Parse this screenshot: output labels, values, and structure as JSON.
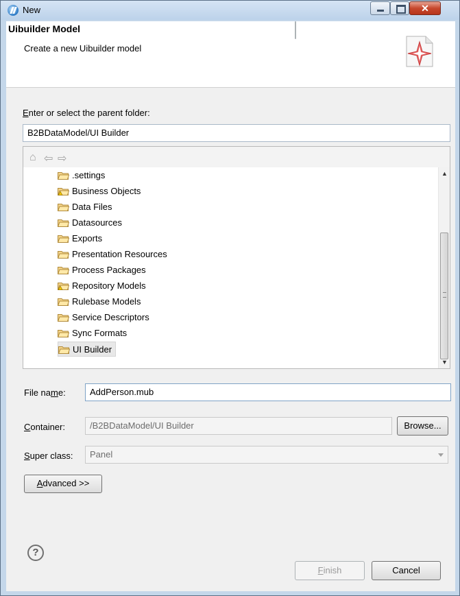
{
  "window": {
    "title": "New"
  },
  "header": {
    "title": "Uibuilder Model",
    "subtitle": "Create a new Uibuilder model"
  },
  "parent_folder": {
    "label_mnemonic": "E",
    "label_rest": "nter or select the parent folder:",
    "value": "B2BDataModel/UI Builder"
  },
  "tree": {
    "items": [
      {
        "label": ".settings",
        "icon": "folder-icon"
      },
      {
        "label": "Business Objects",
        "icon": "folder-warning-icon"
      },
      {
        "label": "Data Files",
        "icon": "folder-icon"
      },
      {
        "label": "Datasources",
        "icon": "folder-icon"
      },
      {
        "label": "Exports",
        "icon": "folder-icon"
      },
      {
        "label": "Presentation Resources",
        "icon": "folder-icon"
      },
      {
        "label": "Process Packages",
        "icon": "folder-icon"
      },
      {
        "label": "Repository Models",
        "icon": "folder-warning-icon"
      },
      {
        "label": "Rulebase Models",
        "icon": "folder-icon"
      },
      {
        "label": "Service Descriptors",
        "icon": "folder-icon"
      },
      {
        "label": "Sync Formats",
        "icon": "folder-icon"
      },
      {
        "label": "UI Builder",
        "icon": "folder-icon",
        "selected": true
      }
    ]
  },
  "file_name": {
    "label_pre": "File na",
    "label_mnemonic": "m",
    "label_post": "e:",
    "value": "AddPerson.mub"
  },
  "container": {
    "label_mnemonic": "C",
    "label_rest": "ontainer:",
    "value": "/B2BDataModel/UI Builder",
    "browse_label": "Browse..."
  },
  "super_class": {
    "label_mnemonic": "S",
    "label_rest": "uper class:",
    "value": "Panel"
  },
  "advanced": {
    "mnemonic": "A",
    "rest": "dvanced >>"
  },
  "footer": {
    "help_glyph": "?",
    "finish_mnemonic": "F",
    "finish_rest": "inish",
    "cancel_label": "Cancel"
  },
  "colors": {
    "title_bar": "#c4d7ea",
    "close_button": "#c7482d",
    "dialog_bg": "#f0f0f0"
  }
}
